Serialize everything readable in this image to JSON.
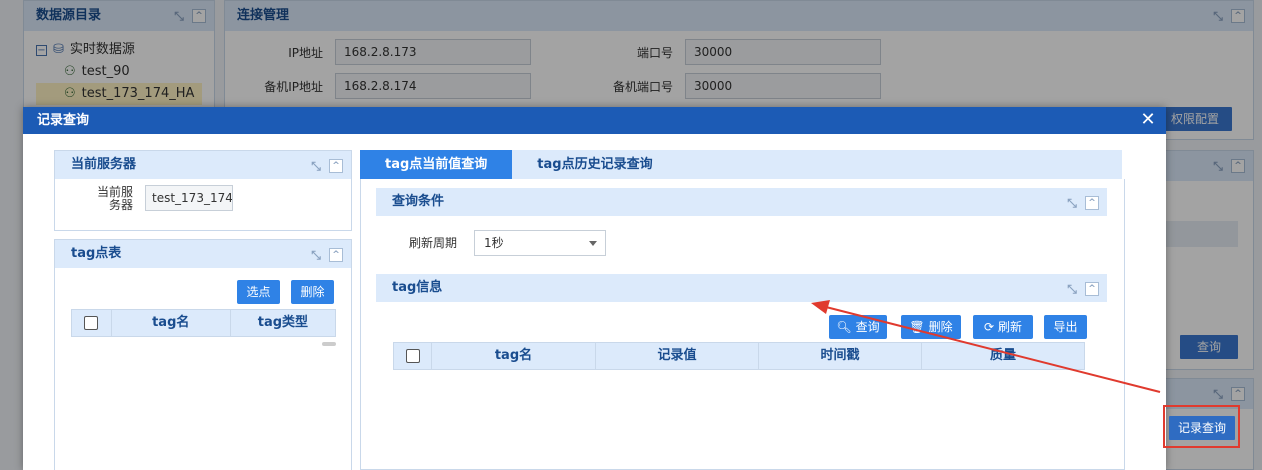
{
  "background": {
    "catalog": {
      "title": "数据源目录",
      "root": "实时数据源",
      "items": [
        "test_90",
        "test_173_174_HA"
      ]
    },
    "connection": {
      "title": "连接管理",
      "ip_label": "IP地址",
      "ip_value": "168.2.8.173",
      "port_label": "端口号",
      "port_value": "30000",
      "backup_ip_label": "备机IP地址",
      "backup_ip_value": "168.2.8.174",
      "backup_port_label": "备机端口号",
      "backup_port_value": "30000",
      "perm_button": "权限配置"
    },
    "query_button": "查询",
    "record_query_button": "记录查询"
  },
  "modal": {
    "title": "记录查询",
    "close_icon": "close-icon",
    "server_panel": {
      "title": "当前服务器",
      "label": "当前服务器",
      "value": "test_173_174_"
    },
    "tag_panel": {
      "title": "tag点表",
      "select_button": "选点",
      "delete_button": "删除",
      "columns": [
        "tag名",
        "tag类型"
      ]
    },
    "tabs": [
      "tag点当前值查询",
      "tag点历史记录查询"
    ],
    "conditions": {
      "title": "查询条件",
      "period_label": "刷新周期",
      "period_value": "1秒"
    },
    "tag_info": {
      "title": "tag信息",
      "query_button": "查询",
      "delete_button": "删除",
      "refresh_button": "刷新",
      "export_button": "导出",
      "columns": [
        "tag名",
        "记录值",
        "时间戳",
        "质量"
      ]
    }
  },
  "colors": {
    "header_blue": "#1c5bb5",
    "button_blue": "#2f82e6",
    "panel_head": "#dceafb",
    "annotation_red": "#e03a2e"
  }
}
